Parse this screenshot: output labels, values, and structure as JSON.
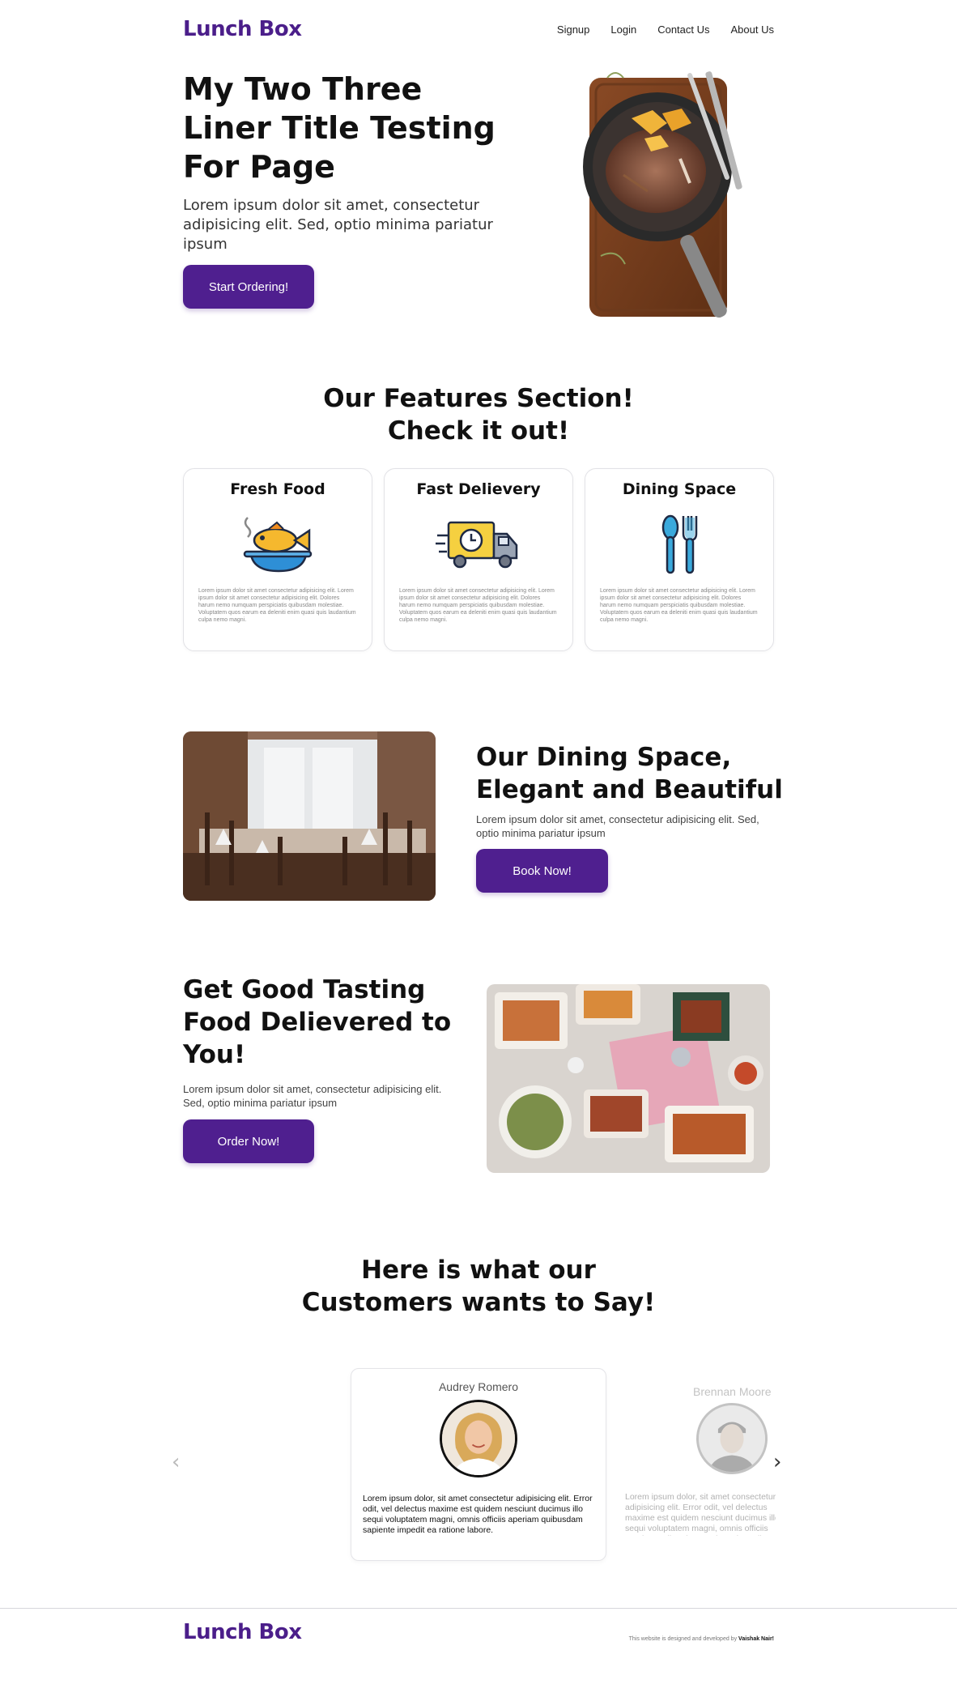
{
  "brand": {
    "name": "Lunch Box",
    "color": "#4b1e8a"
  },
  "nav": {
    "links": [
      "Signup",
      "Login",
      "Contact Us",
      "About Us"
    ]
  },
  "hero": {
    "title": "My Two Three Liner Title Testing For Page",
    "text": "Lorem ipsum dolor sit amet, consectetur adipisicing elit. Sed, optio minima pariatur ipsum",
    "button": "Start Ordering!"
  },
  "features": {
    "title_line1": "Our Features Section!",
    "title_line2": "Check it out!",
    "cards": [
      {
        "title": "Fresh Food",
        "icon": "fish-bowl-icon",
        "text": "Lorem ipsum dolor sit amet consectetur adipisicing elit. Lorem ipsum dolor sit amet consectetur adipisicing elit. Dolores harum nemo numquam perspiciatis quibusdam molestiae. Voluptatem quos earum ea deleniti enim quasi quis laudantium culpa nemo magni."
      },
      {
        "title": "Fast Delievery",
        "icon": "delivery-truck-icon",
        "text": "Lorem ipsum dolor sit amet consectetur adipisicing elit. Lorem ipsum dolor sit amet consectetur adipisicing elit. Dolores harum nemo numquam perspiciatis quibusdam molestiae. Voluptatem quos earum ea deleniti enim quasi quis laudantium culpa nemo magni."
      },
      {
        "title": "Dining Space",
        "icon": "spoon-fork-icon",
        "text": "Lorem ipsum dolor sit amet consectetur adipisicing elit. Lorem ipsum dolor sit amet consectetur adipisicing elit. Dolores harum nemo numquam perspiciatis quibusdam molestiae. Voluptatem quos earum ea deleniti enim quasi quis laudantium culpa nemo magni."
      }
    ]
  },
  "dining": {
    "title": "Our Dining Space, Elegant and Beautiful",
    "text": "Lorem ipsum dolor sit amet, consectetur adipisicing elit. Sed, optio minima pariatur ipsum",
    "button": "Book Now!"
  },
  "delivery": {
    "title": "Get Good Tasting Food Delievered to You!",
    "text": "Lorem ipsum dolor sit amet, consectetur adipisicing elit. Sed, optio minima pariatur ipsum",
    "button": "Order Now!"
  },
  "testimonials": {
    "title_line1": "Here is what our",
    "title_line2": "Customers wants to Say!",
    "items": [
      {
        "name": "Audrey Romero",
        "text": "Lorem ipsum dolor, sit amet consectetur adipisicing elit. Error odit, vel delectus maxime est quidem nesciunt ducimus illo sequi voluptatem magni, omnis officiis aperiam quibusdam sapiente impedit ea ratione labore."
      },
      {
        "name": "Brennan Moore",
        "text": "Lorem ipsum dolor, sit amet consectetur adipisicing elit. Error odit, vel delectus maxime est quidem nesciunt ducimus illo sequi voluptatem magni, omnis officiis aperiam quibusdam sapiente impedit ea ratione labore."
      }
    ],
    "prev_icon": "chevron-left-icon",
    "next_icon": "chevron-right-icon"
  },
  "footer": {
    "logo": "Lunch Box",
    "credit_prefix": "This website is designed and developed by",
    "credit_name": "Vaishak Nair!"
  }
}
